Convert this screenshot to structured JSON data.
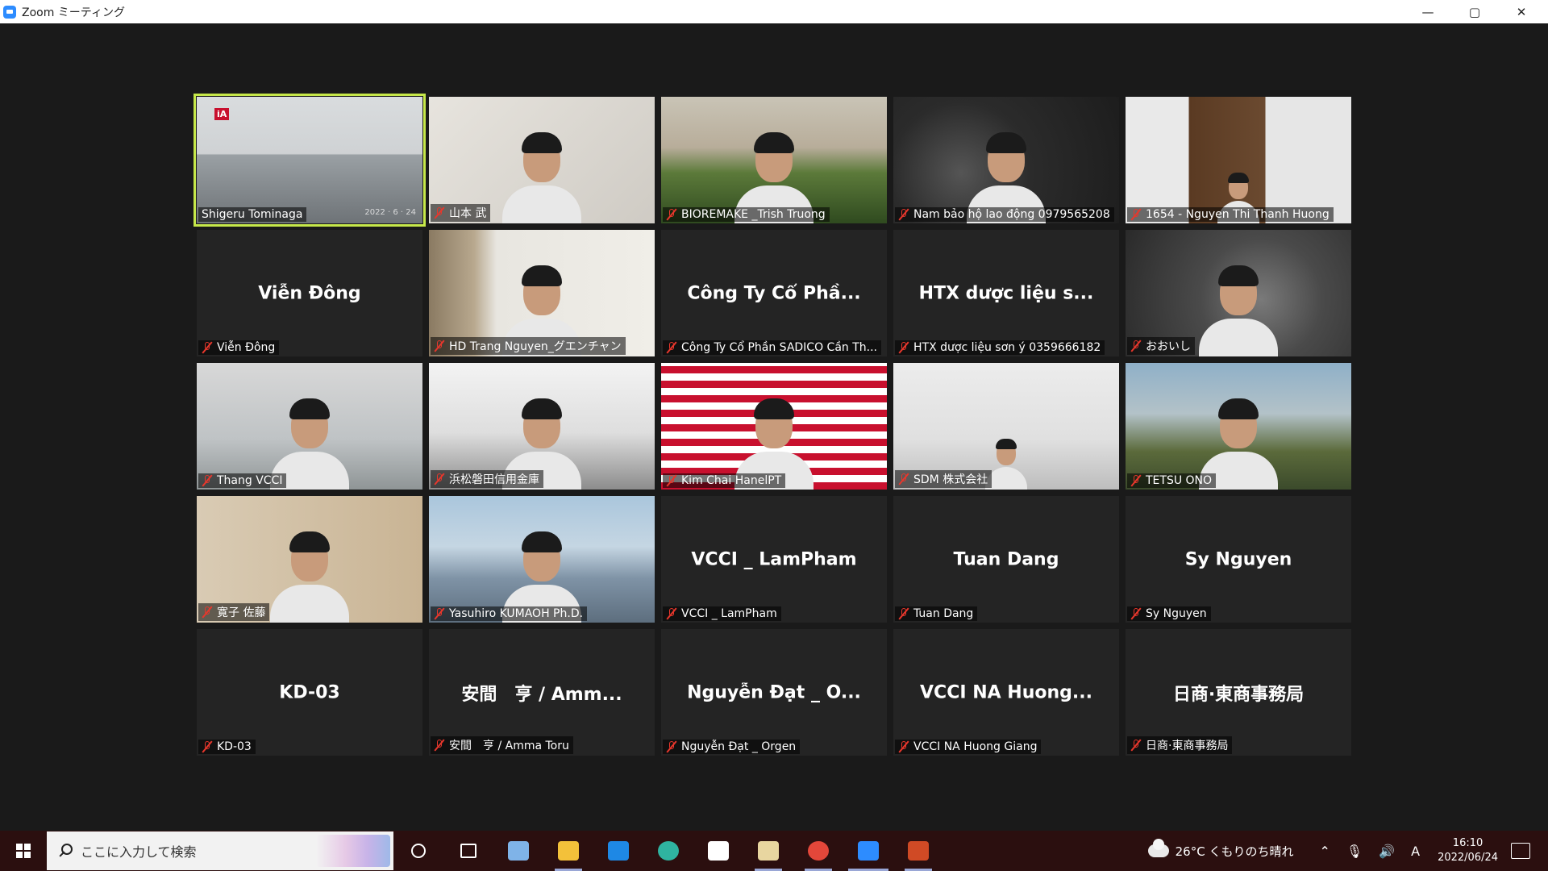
{
  "window": {
    "title": "Zoom ミーティング",
    "controls": {
      "minimize": "—",
      "maximize": "▢",
      "close": "✕"
    }
  },
  "participants": [
    {
      "label": "Shigeru Tominaga",
      "video": "room",
      "badge": "iA",
      "stamp": "2022 · 6 · 24",
      "active": true
    },
    {
      "label": "山本 武",
      "video": "wall"
    },
    {
      "label": "BIOREMAKE _Trish Truong",
      "video": "garden"
    },
    {
      "label": "Nam bảo hộ lao động 0979565208",
      "video": "dark"
    },
    {
      "label": "1654 - Nguyen Thi Thanh Huong",
      "video": "door"
    },
    {
      "label": "Viễn Đông",
      "center": "Viễn Đông"
    },
    {
      "label": "HD Trang Nguyen_グエンチャン",
      "video": "shelf"
    },
    {
      "label": "Công Ty Cổ Phần SADICO Cần Th...",
      "center": "Công Ty Cổ Phầ..."
    },
    {
      "label": "HTX dược liệu sơn ý 0359666182",
      "center": "HTX dược liệu s..."
    },
    {
      "label": "おおいし",
      "video": "blur"
    },
    {
      "label": "Thang VCCI",
      "video": "office"
    },
    {
      "label": "浜松磐田信用金庫",
      "video": "ceiling"
    },
    {
      "label": "Kim Chai HanelPT",
      "video": "brand"
    },
    {
      "label": "SDM 株式会社",
      "video": "white"
    },
    {
      "label": "TETSU ONO",
      "video": "outdoor"
    },
    {
      "label": "寛子 佐藤",
      "video": "home"
    },
    {
      "label": "Yasuhiro KUMAOH Ph.D.",
      "video": "fuji"
    },
    {
      "label": "VCCI _ LamPham",
      "center": "VCCI _ LamPham"
    },
    {
      "label": "Tuan Dang",
      "center": "Tuan Dang"
    },
    {
      "label": "Sy Nguyen",
      "center": "Sy Nguyen"
    },
    {
      "label": "KD-03",
      "center": "KD-03"
    },
    {
      "label": "安間　亨 / Amma Toru",
      "center": "安間　亨 / Amm..."
    },
    {
      "label": "Nguyễn Đạt _ Orgen",
      "center": "Nguyễn Đạt _ O..."
    },
    {
      "label": "VCCI NA Huong Giang",
      "center": "VCCI NA Huong..."
    },
    {
      "label": "日商·東商事務局",
      "center": "日商·東商事務局"
    }
  ],
  "taskbar": {
    "search_placeholder": "ここに入力して検索",
    "apps": [
      {
        "name": "cortana-icon",
        "color": "#ffffff"
      },
      {
        "name": "task-view-icon",
        "color": "#ffffff"
      },
      {
        "name": "paint-app-icon",
        "color": "#7fb3e8"
      },
      {
        "name": "file-explorer-icon",
        "color": "#f3c13a"
      },
      {
        "name": "mail-icon",
        "color": "#1e88e5"
      },
      {
        "name": "edge-icon",
        "color": "#2fb3a0"
      },
      {
        "name": "store-icon",
        "color": "#ffffff"
      },
      {
        "name": "paint-palette-icon",
        "color": "#e8d6a0"
      },
      {
        "name": "chrome-icon",
        "color": "#e3473a"
      },
      {
        "name": "zoom-icon",
        "color": "#2d8cff"
      },
      {
        "name": "powerpoint-icon",
        "color": "#d04a25"
      }
    ],
    "weather": "26°C くもりのち晴れ",
    "ime": "A",
    "time": "16:10",
    "date": "2022/06/24"
  }
}
